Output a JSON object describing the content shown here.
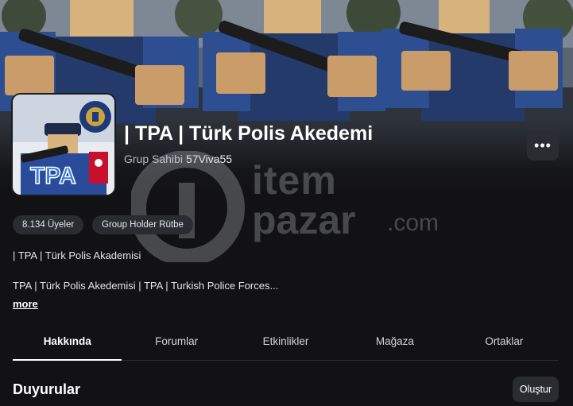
{
  "group": {
    "name": "| TPA | Türk Polis Akedemi",
    "owner_prefix": "Grup Sahibi",
    "owner_name": "57Viva55",
    "icon_text": "TPA"
  },
  "chips": {
    "members": "8.134 Üyeler",
    "rank": "Group Holder Rütbe"
  },
  "description": {
    "short": "| TPA | Türk Polis Akademisi",
    "long": "TPA | Türk Polis Akedemisi | TPA | Turkish Police Forces...",
    "more": "more"
  },
  "tabs": [
    {
      "label": "Hakkında",
      "active": true
    },
    {
      "label": "Forumlar",
      "active": false
    },
    {
      "label": "Etkinlikler",
      "active": false
    },
    {
      "label": "Mağaza",
      "active": false
    },
    {
      "label": "Ortaklar",
      "active": false
    }
  ],
  "announcements": {
    "title": "Duyurular",
    "create_label": "Oluştur"
  },
  "more_button": "•••",
  "watermark": {
    "line1": "item",
    "line2": "pazar",
    "suffix": ".com"
  }
}
